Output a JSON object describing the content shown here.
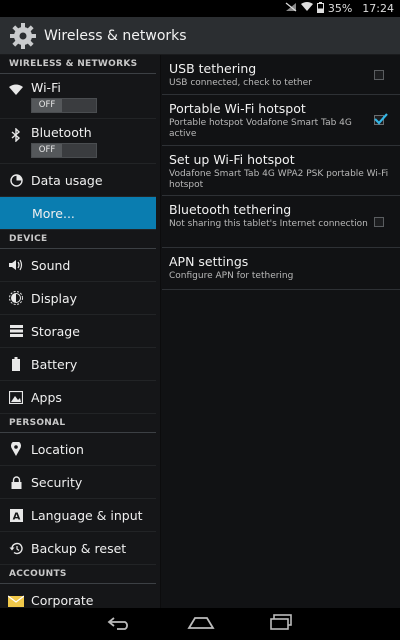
{
  "status_bar": {
    "battery_percent": "35%",
    "time": "17:24"
  },
  "header": {
    "title": "Wireless & networks"
  },
  "sidebar": {
    "sections": [
      {
        "header": "WIRELESS & NETWORKS"
      },
      {
        "header": "DEVICE"
      },
      {
        "header": "PERSONAL"
      },
      {
        "header": "ACCOUNTS"
      }
    ],
    "items": [
      {
        "label": "Wi-Fi",
        "toggle": "OFF"
      },
      {
        "label": "Bluetooth",
        "toggle": "OFF"
      },
      {
        "label": "Data usage"
      },
      {
        "label": "More..."
      },
      {
        "label": "Sound"
      },
      {
        "label": "Display"
      },
      {
        "label": "Storage"
      },
      {
        "label": "Battery"
      },
      {
        "label": "Apps"
      },
      {
        "label": "Location"
      },
      {
        "label": "Security"
      },
      {
        "label": "Language & input"
      },
      {
        "label": "Backup & reset"
      },
      {
        "label": "Corporate"
      }
    ]
  },
  "settings": [
    {
      "title": "USB tethering",
      "summary": "USB connected, check to tether",
      "checked": false
    },
    {
      "title": "Portable Wi-Fi hotspot",
      "summary": "Portable hotspot Vodafone Smart Tab 4G active",
      "checked": true
    },
    {
      "title": "Set up Wi-Fi hotspot",
      "summary": "Vodafone Smart Tab 4G WPA2 PSK portable Wi-Fi hotspot"
    },
    {
      "title": "Bluetooth tethering",
      "summary": "Not sharing this tablet's Internet connection",
      "checked": false
    },
    {
      "title": "APN settings",
      "summary": "Configure APN for tethering"
    }
  ],
  "colors": {
    "accent": "#0a7db0",
    "check": "#33b5e5"
  }
}
